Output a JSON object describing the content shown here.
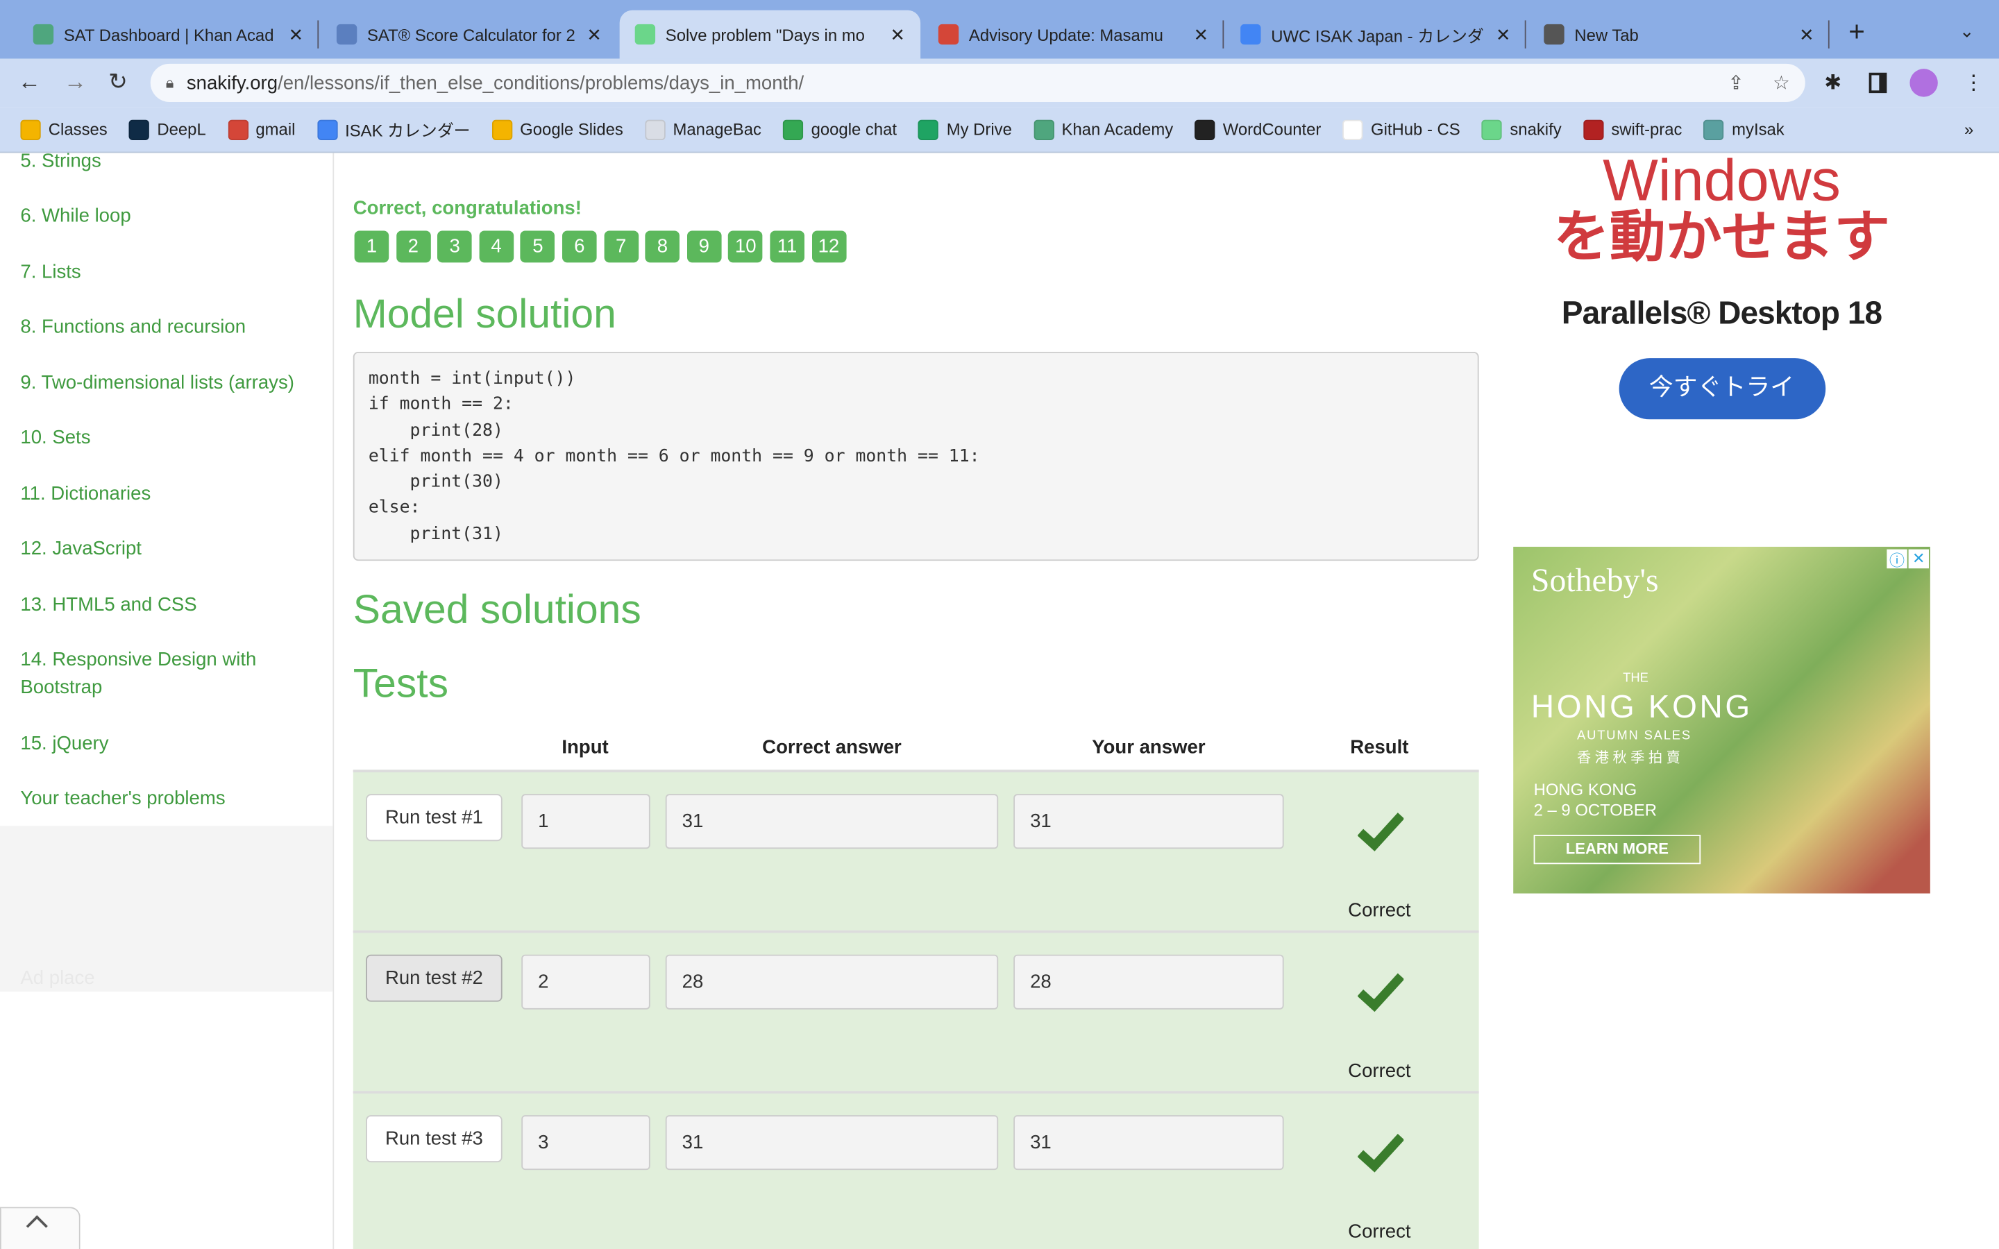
{
  "browser": {
    "tabs": [
      {
        "title": "SAT Dashboard | Khan Acad",
        "icon": "khan-academy-icon",
        "color": "#4fa67e"
      },
      {
        "title": "SAT® Score Calculator for 2",
        "icon": "calculator-icon",
        "color": "#5b7fbf"
      },
      {
        "title": "Solve problem \"Days in mo",
        "icon": "snakify-icon",
        "color": "#6bd68a"
      },
      {
        "title": "Advisory Update: Masamu",
        "icon": "gmail-icon",
        "color": "#d44638"
      },
      {
        "title": "UWC ISAK Japan - カレンダ",
        "icon": "calendar-icon",
        "color": "#4285f4"
      },
      {
        "title": "New Tab",
        "icon": "chrome-icon",
        "color": "#555555"
      }
    ],
    "url_host": "snakify.org",
    "url_path": "/en/lessons/if_then_else_conditions/problems/days_in_month/",
    "bookmarks": [
      {
        "label": "Classes",
        "color": "#f4b400"
      },
      {
        "label": "DeepL",
        "color": "#0f2b46"
      },
      {
        "label": "gmail",
        "color": "#d44638"
      },
      {
        "label": "ISAK カレンダー",
        "color": "#4285f4"
      },
      {
        "label": "Google Slides",
        "color": "#f4b400"
      },
      {
        "label": "ManageBac",
        "color": "#d9dde5"
      },
      {
        "label": "google chat",
        "color": "#34a853"
      },
      {
        "label": "My Drive",
        "color": "#1fa463"
      },
      {
        "label": "Khan Academy",
        "color": "#4fa67e"
      },
      {
        "label": "WordCounter",
        "color": "#222222"
      },
      {
        "label": "GitHub - CS",
        "color": "#ffffff"
      },
      {
        "label": "snakify",
        "color": "#6bd68a"
      },
      {
        "label": "swift-prac",
        "color": "#b22222"
      },
      {
        "label": "myIsak",
        "color": "#5aa0a0"
      }
    ],
    "more_bookmarks": "»"
  },
  "sidebar": {
    "items": [
      "5. Strings",
      "6. While loop",
      "7. Lists",
      "8. Functions and recursion",
      "9. Two-dimensional lists (arrays)",
      "10. Sets",
      "11. Dictionaries",
      "12. JavaScript",
      "13. HTML5 and CSS",
      "14. Responsive Design with Bootstrap",
      "15. jQuery",
      "Your teacher's problems"
    ],
    "ad_place": "Ad place"
  },
  "main": {
    "status": "Correct, congratulations!",
    "attempts": [
      "1",
      "2",
      "3",
      "4",
      "5",
      "6",
      "7",
      "8",
      "9",
      "10",
      "11",
      "12"
    ],
    "model_solution_title": "Model solution",
    "code": "month = int(input())\nif month == 2:\n    print(28)\nelif month == 4 or month == 6 or month == 9 or month == 11:\n    print(30)\nelse:\n    print(31)",
    "saved_title": "Saved solutions",
    "tests_title": "Tests",
    "columns": [
      "Input",
      "Correct answer",
      "Your answer",
      "Result"
    ],
    "tests": [
      {
        "button": "Run test #1",
        "input": "1",
        "correct": "31",
        "yours": "31",
        "result": "Correct"
      },
      {
        "button": "Run test #2",
        "input": "2",
        "correct": "28",
        "yours": "28",
        "result": "Correct"
      },
      {
        "button": "Run test #3",
        "input": "3",
        "correct": "31",
        "yours": "31",
        "result": "Correct"
      }
    ]
  },
  "ads": {
    "parallels": {
      "line1": "Windows",
      "line2": "を動かせます",
      "brand": "Parallels® Desktop 18",
      "cta": "今すぐトライ"
    },
    "sothebys": {
      "brand": "Sotheby's",
      "the": "THE",
      "title": "HONG KONG",
      "sub": "AUTUMN SALES",
      "sub_cn": "香港秋季拍賣",
      "loc": "HONG KONG",
      "dates": "2 – 9 OCTOBER",
      "cta": "LEARN MORE"
    }
  }
}
